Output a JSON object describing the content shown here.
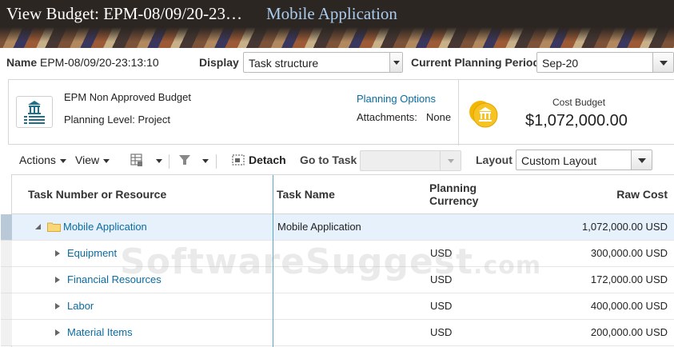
{
  "window": {
    "title": "View Budget: EPM-08/09/20-23…",
    "subtitle": "Mobile Application"
  },
  "header": {
    "name_label": "Name",
    "name_value": "EPM-08/09/20-23:13:10",
    "display_label": "Display",
    "display_value": "Task structure",
    "period_label": "Current Planning Period",
    "period_value": "Sep-20"
  },
  "info": {
    "budget_type": "EPM Non Approved Budget",
    "planning_level": "Planning Level: Project",
    "planning_options": "Planning Options",
    "attachments_label": "Attachments:",
    "attachments_value": "None",
    "cost_budget_label": "Cost Budget",
    "cost_budget_value": "$1,072,000.00"
  },
  "toolbar": {
    "actions": "Actions",
    "view": "View",
    "detach": "Detach",
    "go_to_task": "Go to Task",
    "go_to_task_value": "",
    "layout_label": "Layout",
    "layout_value": "Custom Layout"
  },
  "grid": {
    "columns": [
      "Task Number or Resource",
      "Task Name",
      "Planning",
      "Currency",
      "Raw Cost"
    ],
    "rows": [
      {
        "resource": "Mobile Application",
        "task_name": "Mobile Application",
        "currency": "",
        "raw_cost": "1,072,000.00 USD"
      },
      {
        "resource": "Equipment",
        "task_name": "",
        "currency": "USD",
        "raw_cost": "300,000.00 USD"
      },
      {
        "resource": "Financial Resources",
        "task_name": "",
        "currency": "USD",
        "raw_cost": "172,000.00 USD"
      },
      {
        "resource": "Labor",
        "task_name": "",
        "currency": "USD",
        "raw_cost": "400,000.00 USD"
      },
      {
        "resource": "Material Items",
        "task_name": "",
        "currency": "USD",
        "raw_cost": "200,000.00 USD"
      }
    ]
  },
  "watermark": {
    "text": "SoftwareSuggest",
    "suffix": ".com"
  },
  "colors": {
    "link": "#0a6ca1",
    "title_bg": "#2c2622",
    "subtitle": "#a9cbee",
    "selected_row": "#e6f1fb",
    "coin": "#f2b705"
  },
  "icons": [
    "budget-document-icon",
    "coin-bank-icon",
    "freeze-columns-icon",
    "filter-icon",
    "detach-icon",
    "expand-icon",
    "collapse-icon",
    "folder-icon"
  ]
}
